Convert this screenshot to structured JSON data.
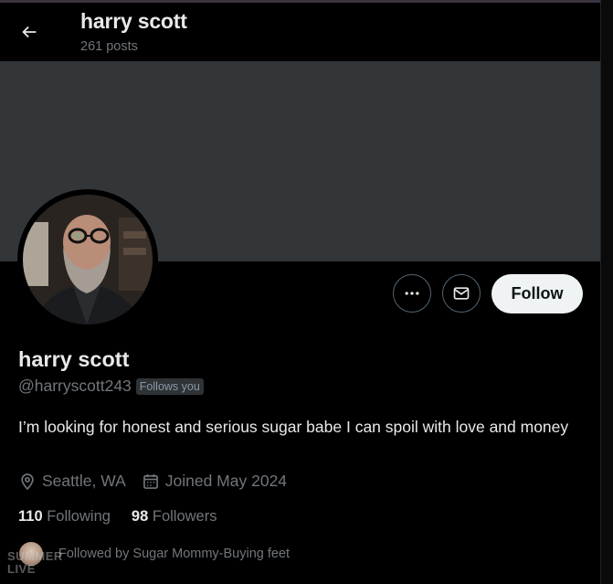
{
  "header": {
    "title": "harry scott",
    "post_count": "261 posts"
  },
  "actions": {
    "follow_label": "Follow"
  },
  "profile": {
    "name": "harry scott",
    "handle": "@harryscott243",
    "follows_you_badge": "Follows you",
    "bio": "I’m looking for honest and serious sugar babe I can spoil with love and money",
    "location": "Seattle, WA",
    "joined": "Joined May 2024"
  },
  "stats": {
    "following_count": "110",
    "following_label": "Following",
    "followers_count": "98",
    "followers_label": "Followers"
  },
  "followed_by": {
    "text": "Followed by Sugar Mommy-Buying feet"
  },
  "watermark": {
    "line1": "SUMMER",
    "line2": "LIVE"
  },
  "colors": {
    "background": "#000000",
    "banner": "#333639",
    "text_primary": "#e7e9ea",
    "text_secondary": "#71767b",
    "follow_button_bg": "#eff3f4"
  }
}
